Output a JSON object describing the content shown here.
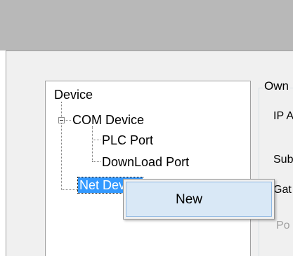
{
  "tree": {
    "root_label": "Device",
    "com_device_label": "COM Device",
    "plc_port_label": "PLC Port",
    "download_port_label": "DownLoad Port",
    "net_device_label": "Net Device"
  },
  "group_box": {
    "title": "Own",
    "labels": [
      "IP A",
      "Sub",
      "Gat",
      "Po"
    ]
  },
  "context_menu": {
    "items": [
      {
        "label": "New"
      }
    ]
  }
}
